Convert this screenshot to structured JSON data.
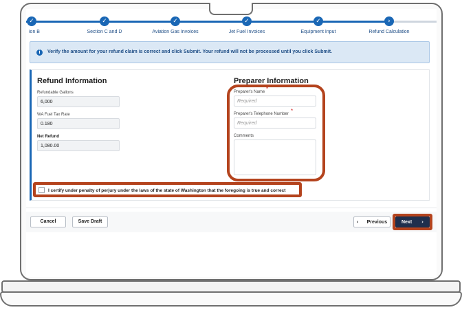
{
  "stepper": {
    "steps": [
      {
        "label": "ion B"
      },
      {
        "label": "Section C and D"
      },
      {
        "label": "Aviation Gas Invoices"
      },
      {
        "label": "Jet Fuel Invoices"
      },
      {
        "label": "Equipment Input"
      },
      {
        "label": "Refund Calculation"
      }
    ],
    "done_glyph": "✓",
    "current_glyph": "›"
  },
  "alert": {
    "icon": "info-icon",
    "glyph": "i",
    "text": "Verify the amount for your refund claim is correct and click Submit. Your refund will not be processed until you click Submit."
  },
  "refund": {
    "title": "Refund Information",
    "gallons_label": "Refundable Gallons",
    "gallons_value": "6,000",
    "rate_label": "WA Fuel Tax Rate",
    "rate_value": "0.180",
    "net_label": "Net Refund",
    "net_value": "1,080.00"
  },
  "preparer": {
    "title": "Preparer Information",
    "name_label": "Preparer's Name",
    "name_placeholder": "Required",
    "phone_label": "Preparer's Telephone Number",
    "phone_placeholder": "Required",
    "comments_label": "Comments",
    "required_mark": "*"
  },
  "certify": {
    "text": "I certify under penalty of perjury under the laws of the state of Washington that the foregoing is true and correct",
    "required_mark": "*"
  },
  "actions": {
    "cancel": "Cancel",
    "save_draft": "Save Draft",
    "previous": "Previous",
    "next": "Next",
    "prev_glyph": "‹",
    "next_glyph": "›"
  },
  "colors": {
    "accent": "#1a67b5",
    "highlight": "#b4431d",
    "primary_button": "#1f2f4d"
  }
}
